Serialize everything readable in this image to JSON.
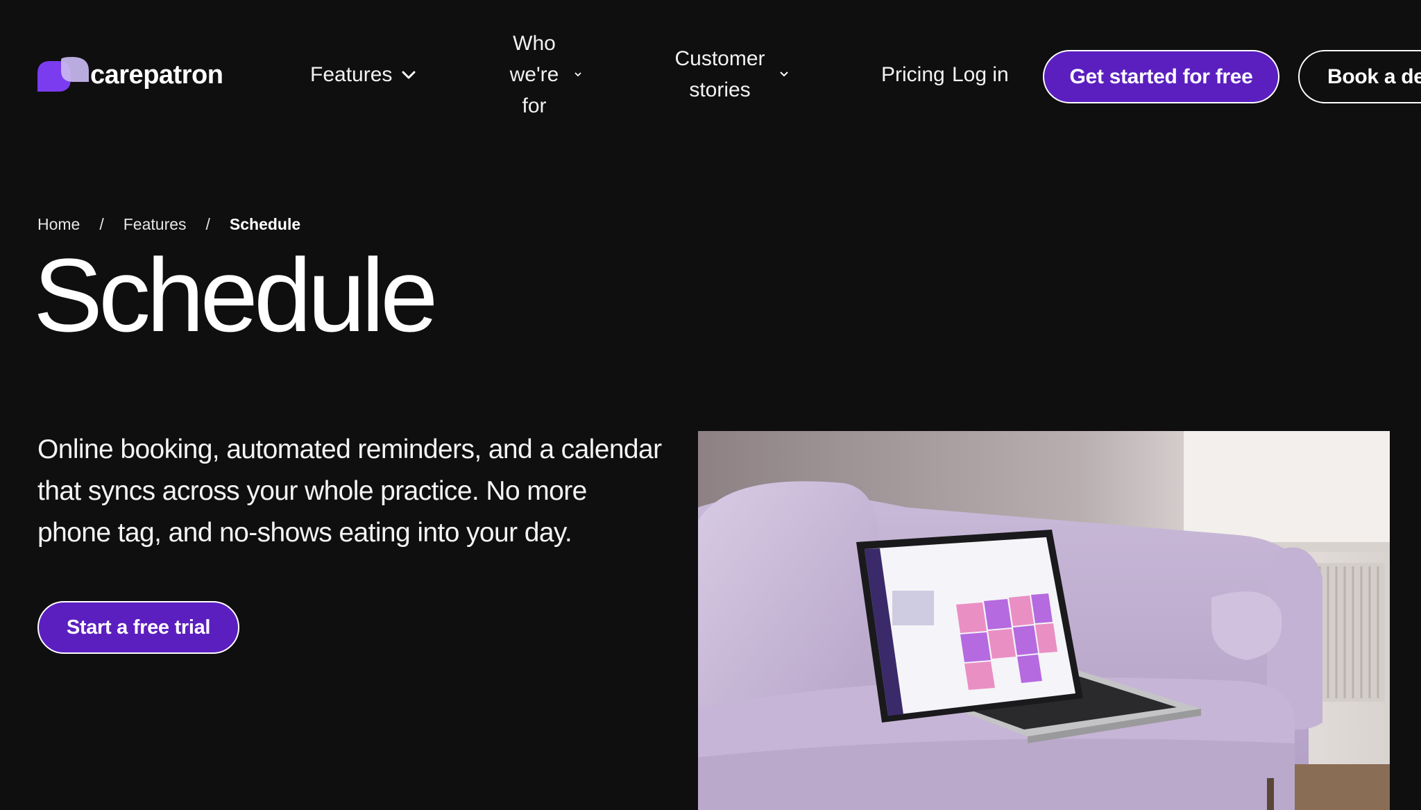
{
  "header": {
    "logo_text": "carepatron",
    "nav": {
      "features": "Features",
      "who_line1": "Who",
      "who_line2": "we're",
      "who_line3": "for",
      "stories_line1": "Customer",
      "stories_line2": "stories",
      "pricing": "Pricing",
      "login": "Log in"
    },
    "cta_primary": "Get started for free",
    "cta_secondary": "Book a de"
  },
  "breadcrumb": {
    "home": "Home",
    "features": "Features",
    "current": "Schedule",
    "separator": "/"
  },
  "hero": {
    "title": "Schedule",
    "description": "Online booking, automated reminders, and a calendar that syncs across your whole practice. No more phone tag, and no-shows eating into your day.",
    "cta": "Start a free trial",
    "image_alt_icon": "laptop-on-sofa-image"
  },
  "colors": {
    "background": "#0f0f0f",
    "accent": "#5b1fc0",
    "text": "#ffffff",
    "logo_purple": "#7b3cf0",
    "logo_lavender": "#c9b8f0"
  }
}
